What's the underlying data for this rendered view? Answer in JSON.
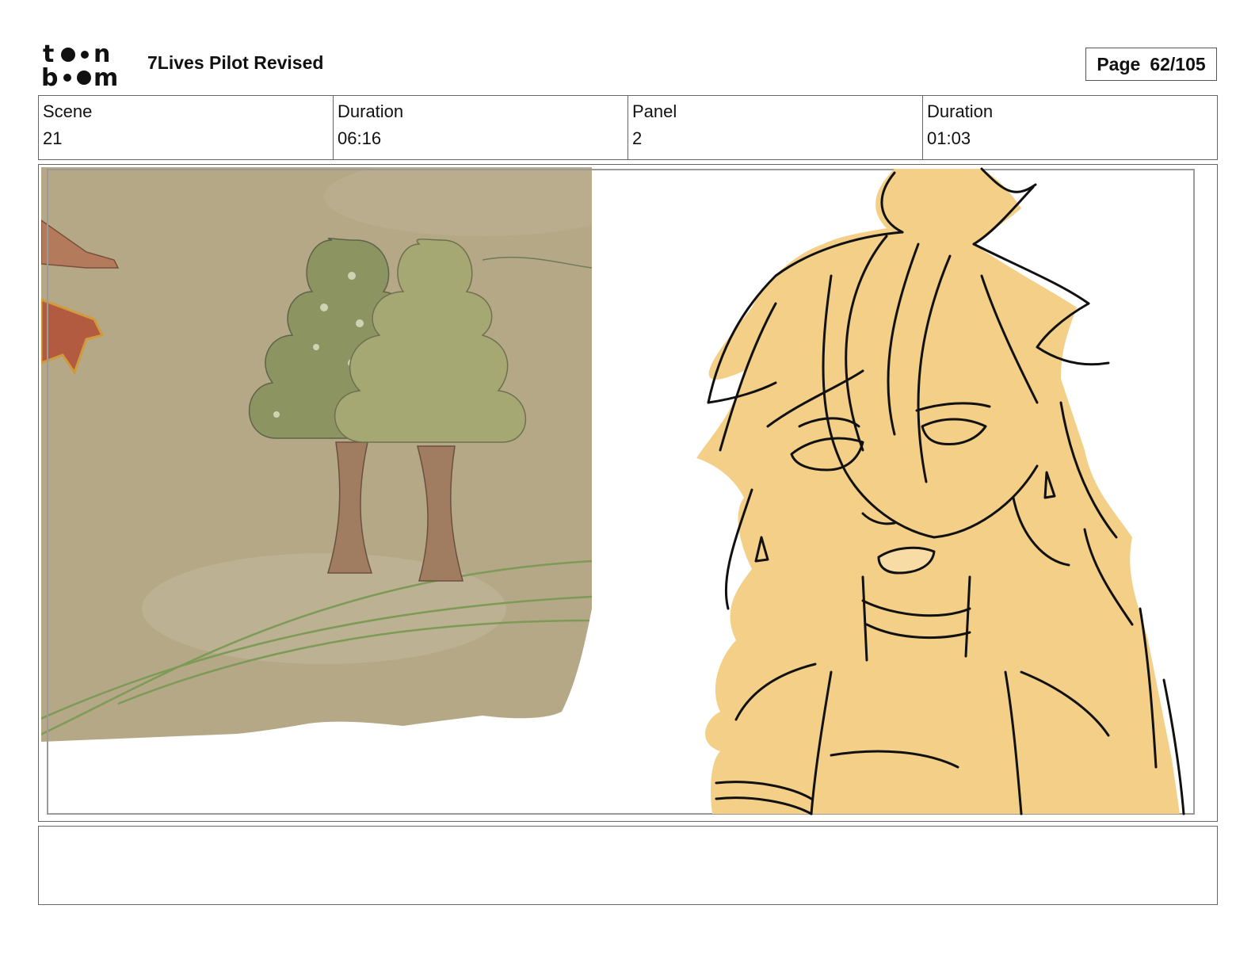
{
  "header": {
    "logo_text": "toon boom",
    "document_title": "7Lives Pilot Revised",
    "page": {
      "label": "Page",
      "value": "62/105"
    }
  },
  "info": {
    "scene_label": "Scene",
    "scene_value": "21",
    "scene_duration_label": "Duration",
    "scene_duration_value": "06:16",
    "panel_label": "Panel",
    "panel_value": "2",
    "panel_duration_label": "Duration",
    "panel_duration_value": "01:03"
  },
  "panel": {
    "background_color": "#b5a886",
    "tree_left_color": "#8c9462",
    "tree_right_color": "#a6a874",
    "trunk_color": "#a07c60",
    "hair_color": "#f3cf88",
    "line_color": "#111111"
  },
  "notes": {
    "text": ""
  }
}
